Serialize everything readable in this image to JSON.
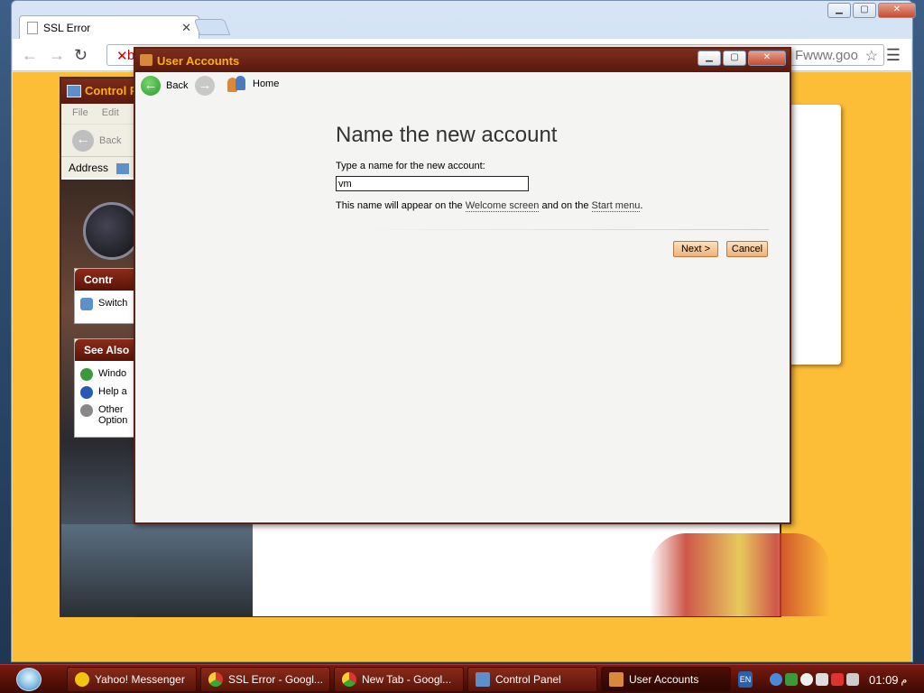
{
  "chrome": {
    "tab_title": "SSL Error",
    "omnibox_fragment": "b",
    "omnibox_right_text": "Fwww.goo"
  },
  "control_panel": {
    "title": "Control P",
    "menu": [
      "File",
      "Edit"
    ],
    "back_label": "Back",
    "address_label": "Address",
    "panel_partial_title": "Contr",
    "switch_item": "Switch",
    "see_also": {
      "title": "See Also",
      "items": [
        "Windo",
        "Help a",
        "Other",
        "Option"
      ]
    }
  },
  "user_accounts": {
    "title": "User Accounts",
    "nav": {
      "back": "Back",
      "home": "Home"
    },
    "heading": "Name the new account",
    "prompt": "Type a name for the new account:",
    "input_value": "vm",
    "note_pre": "This name will appear on the ",
    "note_link1": "Welcome screen",
    "note_mid": " and on the ",
    "note_link2": "Start menu",
    "note_post": ".",
    "next_label": "Next >",
    "cancel_label": "Cancel"
  },
  "taskbar": {
    "tasks": [
      {
        "label": "Yahoo! Messenger"
      },
      {
        "label": "SSL Error - Googl..."
      },
      {
        "label": "New Tab - Googl..."
      },
      {
        "label": "Control Panel"
      },
      {
        "label": "User Accounts"
      }
    ],
    "lang": "EN",
    "clock": "01:09",
    "clock_suffix": "م"
  },
  "colors": {
    "chrome_page_bg": "#fcbd37",
    "titlebar": "#5a180c",
    "title_text": "#ffb000",
    "dialog_button": "#efb27a"
  }
}
